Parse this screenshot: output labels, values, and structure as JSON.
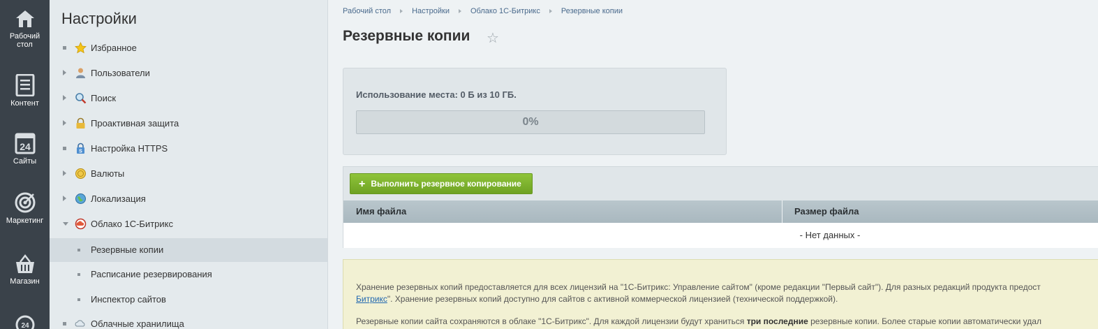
{
  "rail": {
    "items": [
      {
        "label_1": "Рабочий",
        "label_2": "стол",
        "icon": "home-icon"
      },
      {
        "label_1": "Контент",
        "icon": "document-icon"
      },
      {
        "label_1": "Сайты",
        "icon": "calendar-24-icon"
      },
      {
        "label_1": "Маркетинг",
        "icon": "target-icon"
      },
      {
        "label_1": "Магазин",
        "icon": "basket-icon"
      }
    ]
  },
  "settings": {
    "title": "Настройки",
    "items": [
      {
        "label": "Избранное",
        "icon": "star-icon"
      },
      {
        "label": "Пользователи",
        "icon": "user-icon"
      },
      {
        "label": "Поиск",
        "icon": "magnifier-icon"
      },
      {
        "label": "Проактивная защита",
        "icon": "lock-icon"
      },
      {
        "label": "Настройка HTTPS",
        "icon": "shield-lock-icon"
      },
      {
        "label": "Валюты",
        "icon": "coin-icon"
      },
      {
        "label": "Локализация",
        "icon": "globe-icon"
      },
      {
        "label": "Облако 1С-Битрикс",
        "icon": "cloud-icon"
      },
      {
        "label": "Резервные копии"
      },
      {
        "label": "Расписание резервирования"
      },
      {
        "label": "Инспектор сайтов"
      },
      {
        "label": "Облачные хранилища",
        "icon": "cloud-storage-icon"
      }
    ]
  },
  "breadcrumb": [
    "Рабочий стол",
    "Настройки",
    "Облако 1С-Битрикс",
    "Резервные копии"
  ],
  "page": {
    "title": "Резервные копии"
  },
  "usage": {
    "text": "Использование места: 0 Б из 10 ГБ.",
    "percent_label": "0%",
    "fraction": 0
  },
  "backup": {
    "button_label": "Выполнить резервное копирование",
    "columns": [
      "Имя файла",
      "Размер файла"
    ],
    "empty_text": "- Нет данных -"
  },
  "info": {
    "p1_line1": "Хранение резервных копий предоставляется для всех лицензий на \"1С-Битрикс: Управление сайтом\" (кроме редакции \"Первый сайт\"). Для разных редакций продукта предост",
    "p1_link": "Битрикс",
    "p1_line2": "\". Хранение резервных копий доступно для сайтов с активной коммерческой лицензией (технической поддержкой).",
    "p2_start": "Резервные копии сайта сохраняются в облаке \"1С-Битрикс\". Для каждой лицензии будут храниться ",
    "p2_bold": "три последние",
    "p2_end": " резервные копии. Более старые копии автоматически удал"
  },
  "colors": {
    "rail_bg": "#3a424a",
    "accent_green": "#7ab22e",
    "link": "#2067b0"
  }
}
